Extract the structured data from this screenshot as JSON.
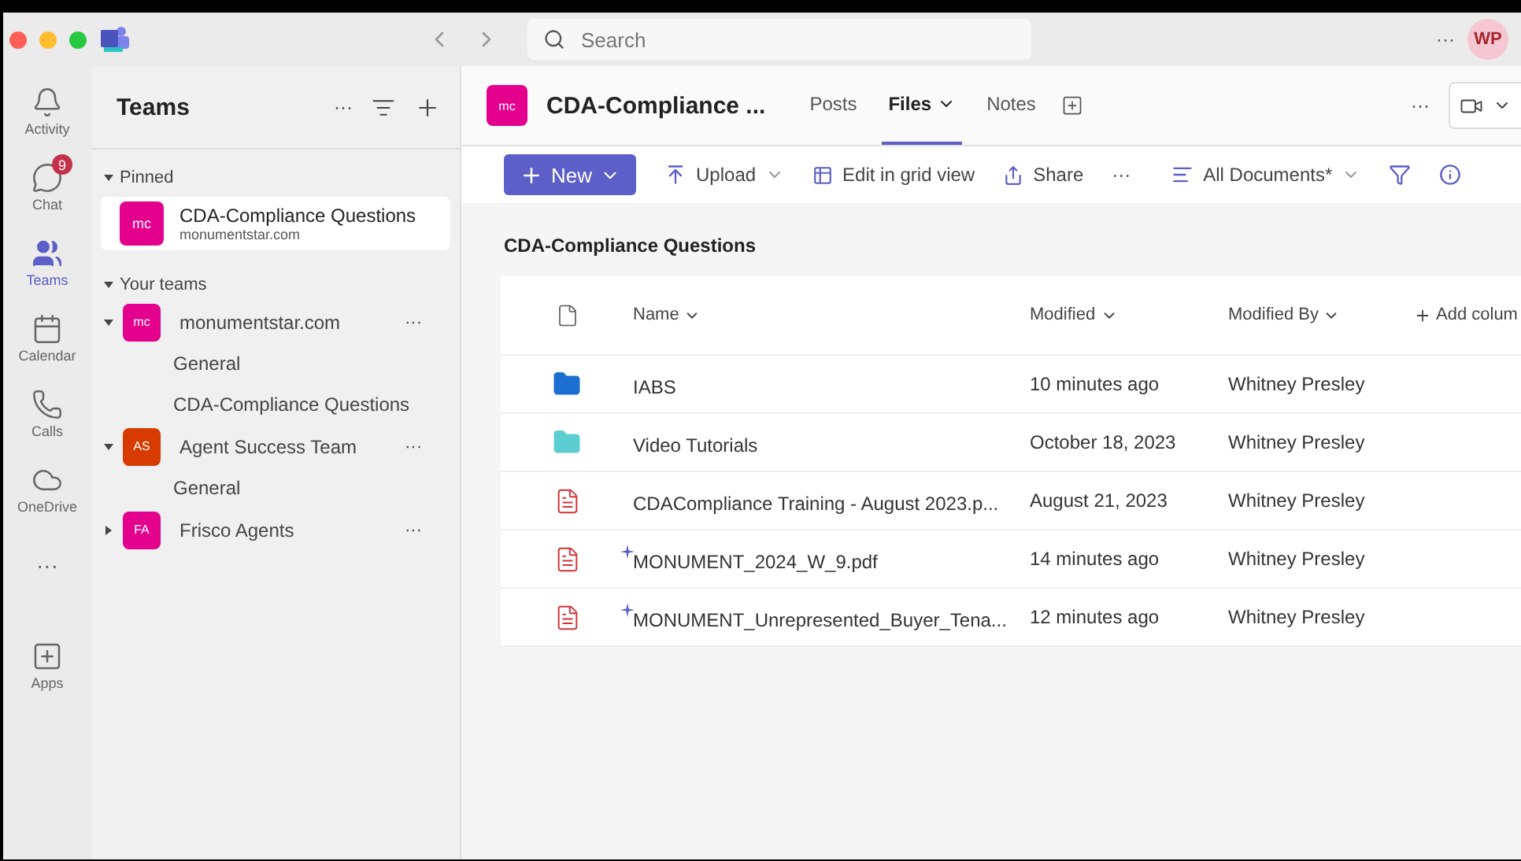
{
  "titlebar": {
    "search": {
      "placeholder": "Search"
    },
    "more": "···",
    "avatar": "WP"
  },
  "rail": [
    {
      "kind": "activity",
      "label": "Activity",
      "selected": false
    },
    {
      "kind": "chat",
      "label": "Chat",
      "selected": false,
      "badge": "9"
    },
    {
      "kind": "teams",
      "label": "Teams",
      "selected": true
    },
    {
      "kind": "calendar",
      "label": "Calendar",
      "selected": false
    },
    {
      "kind": "calls",
      "label": "Calls",
      "selected": false
    },
    {
      "kind": "onedrive",
      "label": "OneDrive",
      "selected": false
    },
    {
      "kind": "more",
      "label": "···",
      "selected": false
    },
    {
      "kind": "apps",
      "label": "Apps",
      "selected": false
    }
  ],
  "sidebar": {
    "title": "Teams",
    "more": "···",
    "sections": [
      {
        "label": "Pinned",
        "expanded": true,
        "items": [
          {
            "avatar": "mc",
            "color": "#e3008c",
            "name": "CDA-Compliance Questions",
            "subtitle": "monumentstar.com",
            "selected": true
          }
        ]
      },
      {
        "label": "Your teams",
        "expanded": true,
        "teams": [
          {
            "avatar": "mc",
            "color": "#e3008c",
            "name": "monumentstar.com",
            "expanded": true,
            "more": "···",
            "channels": [
              "General",
              "CDA-Compliance Questions"
            ]
          },
          {
            "avatar": "AS",
            "color": "#d83b01",
            "name": "Agent Success Team",
            "expanded": true,
            "more": "···",
            "channels": [
              "General"
            ]
          },
          {
            "avatar": "FA",
            "color": "#e3008c",
            "name": "Frisco Agents",
            "expanded": false,
            "more": "···"
          }
        ]
      }
    ]
  },
  "channel": {
    "avatar": "mc",
    "color": "#e3008c",
    "title": "CDA-Compliance ...",
    "tabs": [
      {
        "label": "Posts",
        "selected": false,
        "menu": false
      },
      {
        "label": "Files",
        "selected": true,
        "menu": true
      },
      {
        "label": "Notes",
        "selected": false,
        "menu": false
      }
    ],
    "more": "···"
  },
  "toolbar": {
    "new": "New",
    "upload": "Upload",
    "grid": "Edit in grid view",
    "share": "Share",
    "more": "···",
    "view": "All Documents*"
  },
  "library": {
    "title": "CDA-Compliance Questions",
    "columns": [
      "Name",
      "Modified",
      "Modified By",
      "Add colum"
    ],
    "rows": [
      {
        "kind": "folder",
        "color": "#1a6fd0",
        "new": false,
        "name": "IABS",
        "modified": "10 minutes ago",
        "by": "Whitney Presley"
      },
      {
        "kind": "folder",
        "color": "#5ccdd0",
        "new": false,
        "name": "Video Tutorials",
        "modified": "October 18, 2023",
        "by": "Whitney Presley"
      },
      {
        "kind": "pdf",
        "new": false,
        "name": "CDACompliance Training - August 2023.p...",
        "modified": "August 21, 2023",
        "by": "Whitney Presley"
      },
      {
        "kind": "pdf",
        "new": true,
        "name": "MONUMENT_2024_W_9.pdf",
        "modified": "14 minutes ago",
        "by": "Whitney Presley"
      },
      {
        "kind": "pdf",
        "new": true,
        "name": "MONUMENT_Unrepresented_Buyer_Tena...",
        "modified": "12 minutes ago",
        "by": "Whitney Presley"
      }
    ]
  }
}
